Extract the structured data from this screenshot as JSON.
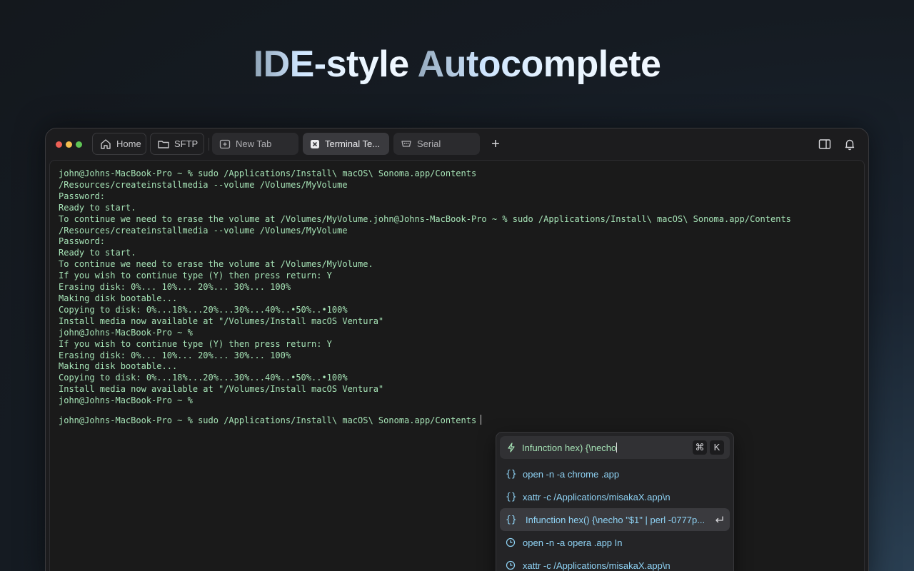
{
  "headline": {
    "part1": "IDE-style",
    "part2": " Autocomplete"
  },
  "tabs": [
    {
      "label": "Home",
      "icon": "home-icon"
    },
    {
      "label": "SFTP",
      "icon": "folder-icon"
    },
    {
      "label": "New Tab",
      "icon": "new-tab-icon"
    },
    {
      "label": "Terminal Te...",
      "icon": "close-icon"
    },
    {
      "label": "Serial",
      "icon": "serial-port-icon"
    }
  ],
  "new_tab_symbol": "+",
  "terminal": {
    "lines": [
      "john@Johns-MacBook-Pro ~ % sudo /Applications/Install\\ macOS\\ Sonoma.app/Contents",
      "/Resources/createinstallmedia --volume /Volumes/MyVolume",
      "Password:",
      "Ready to start.",
      "To continue we need to erase the volume at /Volumes/MyVolume.john@Johns-MacBook-Pro ~ % sudo /Applications/Install\\ macOS\\ Sonoma.app/Contents",
      "/Resources/createinstallmedia --volume /Volumes/MyVolume",
      "Password:",
      "Ready to start.",
      "To continue we need to erase the volume at /Volumes/MyVolume.",
      "If you wish to continue type (Y) then press return: Y",
      "Erasing disk: 0%... 10%... 20%... 30%... 100%",
      "Making disk bootable...",
      "Copying to disk: 0%...18%...20%...30%...40%..•50%..•100%",
      "Install media now available at \"/Volumes/Install macOS Ventura\"",
      "john@Johns-MacBook-Pro ~ %",
      "If you wish to continue type (Y) then press return: Y",
      "Erasing disk: 0%... 10%... 20%... 30%... 100%",
      "Making disk bootable...",
      "Copying to disk: 0%...18%...20%...30%...40%..•50%..•100%",
      "Install media now available at \"/Volumes/Install macOS Ventura\"",
      "john@Johns-MacBook-Pro ~ %"
    ],
    "prompt": "john@Johns-MacBook-Pro ~ % sudo /Applications/Install\\ macOS\\ Sonoma.app/Contents"
  },
  "autocomplete": {
    "query": "Infunction hex) {\\necho",
    "shortcut": [
      "⌘",
      "K"
    ],
    "items": [
      {
        "label": "open -n -a chrome .app",
        "kind": "snippet"
      },
      {
        "label": "xattr -c /Applications/misakaX.app\\n",
        "kind": "snippet"
      },
      {
        "label": "Infunction hex() {\\necho \"$1\" | perl -0777p...",
        "kind": "snippet",
        "selected": true
      },
      {
        "label": "open -n -a opera .app In",
        "kind": "history"
      },
      {
        "label": "xattr -c /Applications/misakaX.app\\n",
        "kind": "history"
      }
    ]
  },
  "colors": {
    "terminal_text": "#a6e3b6",
    "suggestion_text": "#8fd3f5",
    "window_bg": "#1c1c1e"
  }
}
